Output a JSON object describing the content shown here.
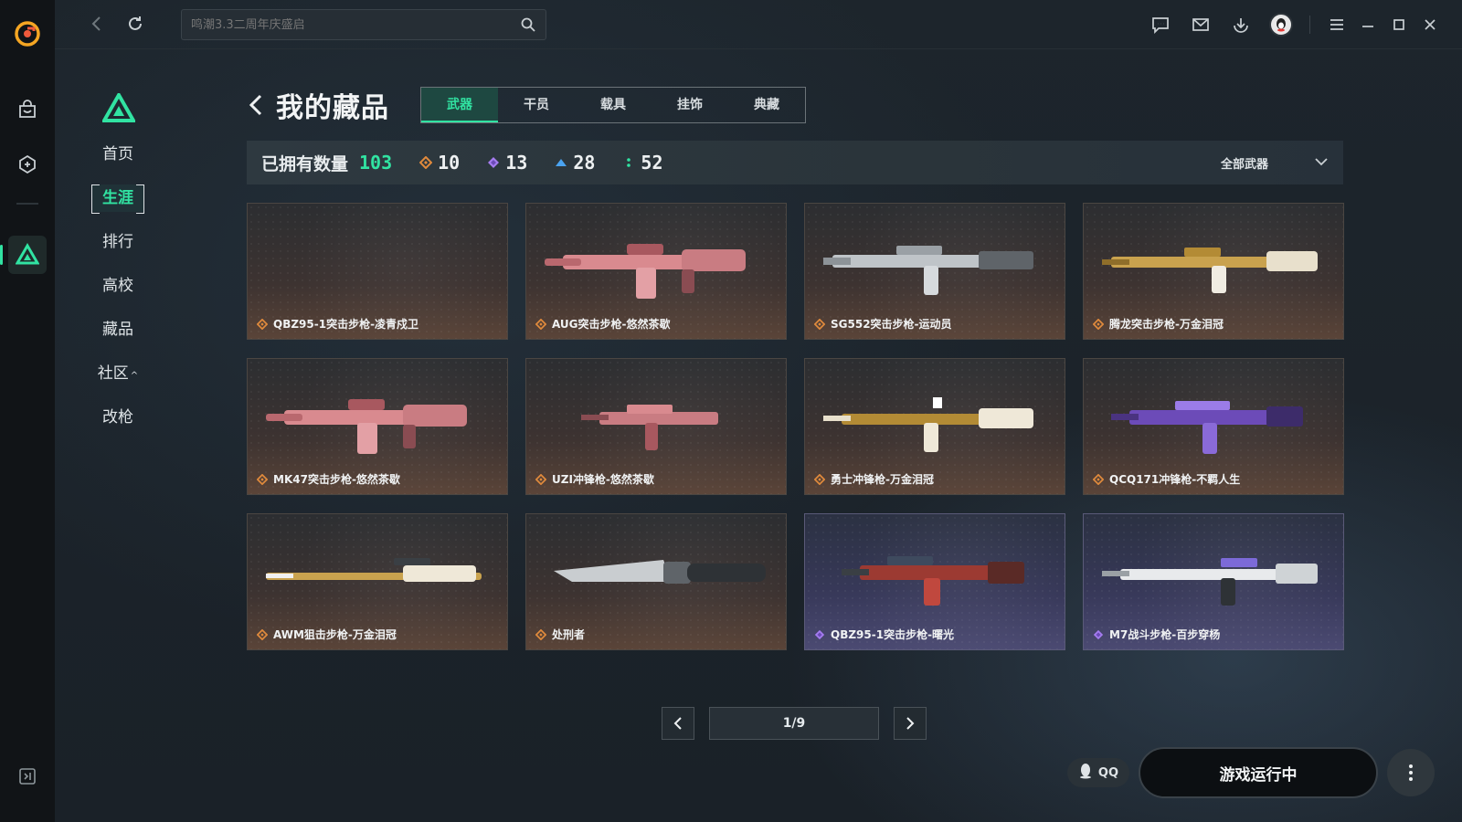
{
  "colors": {
    "accent": "#31e3a2",
    "rarity_gold": "#e08a3c",
    "rarity_purple": "#a57cf0",
    "rarity_blue": "#4aa3f0",
    "rarity_green": "#31e3a2"
  },
  "topbar": {
    "search_placeholder": "鸣潮3.3二周年庆盛启"
  },
  "sidebar": {
    "items": [
      {
        "label": "首页"
      },
      {
        "label": "生涯",
        "active": true
      },
      {
        "label": "排行"
      },
      {
        "label": "高校"
      },
      {
        "label": "藏品"
      },
      {
        "label": "社区",
        "suffix": "^"
      },
      {
        "label": "改枪"
      }
    ]
  },
  "main": {
    "title": "我的藏品",
    "tabs": [
      "武器",
      "干员",
      "载具",
      "挂饰",
      "典藏"
    ],
    "active_tab": "武器",
    "owned_label": "已拥有数量",
    "owned_count": "103",
    "stats": [
      {
        "rarity": "gold",
        "count": "10"
      },
      {
        "rarity": "purple",
        "count": "13"
      },
      {
        "rarity": "blue",
        "count": "28"
      },
      {
        "rarity": "green",
        "count": "52"
      }
    ],
    "filter_label": "全部武器"
  },
  "items": [
    {
      "name": "QBZ95-1突击步枪-凌青戍卫",
      "rarity": "gold",
      "icon": "empty"
    },
    {
      "name": "AUG突击步枪-悠然茶歇",
      "rarity": "gold",
      "icon": "pink-rifle"
    },
    {
      "name": "SG552突击步枪-运动员",
      "rarity": "gold",
      "icon": "silver-rifle"
    },
    {
      "name": "腾龙突击步枪-万金泪冠",
      "rarity": "gold",
      "icon": "gold-rifle"
    },
    {
      "name": "MK47突击步枪-悠然茶歇",
      "rarity": "gold",
      "icon": "pink-rifle"
    },
    {
      "name": "UZI冲锋枪-悠然茶歇",
      "rarity": "gold",
      "icon": "pink-smg"
    },
    {
      "name": "勇士冲锋枪-万金泪冠",
      "rarity": "gold",
      "icon": "gold-smg"
    },
    {
      "name": "QCQ171冲锋枪-不羁人生",
      "rarity": "gold",
      "icon": "purple-smg"
    },
    {
      "name": "AWM狙击步枪-万金泪冠",
      "rarity": "gold",
      "icon": "gold-sniper"
    },
    {
      "name": "处刑者",
      "rarity": "gold",
      "icon": "knife"
    },
    {
      "name": "QBZ95-1突击步枪-曙光",
      "rarity": "purple",
      "icon": "red-rifle"
    },
    {
      "name": "M7战斗步枪-百步穿杨",
      "rarity": "purple",
      "icon": "white-rifle"
    }
  ],
  "pagination": {
    "page": "1/9"
  },
  "bottom": {
    "qq_label": "QQ",
    "run_label": "游戏运行中"
  }
}
